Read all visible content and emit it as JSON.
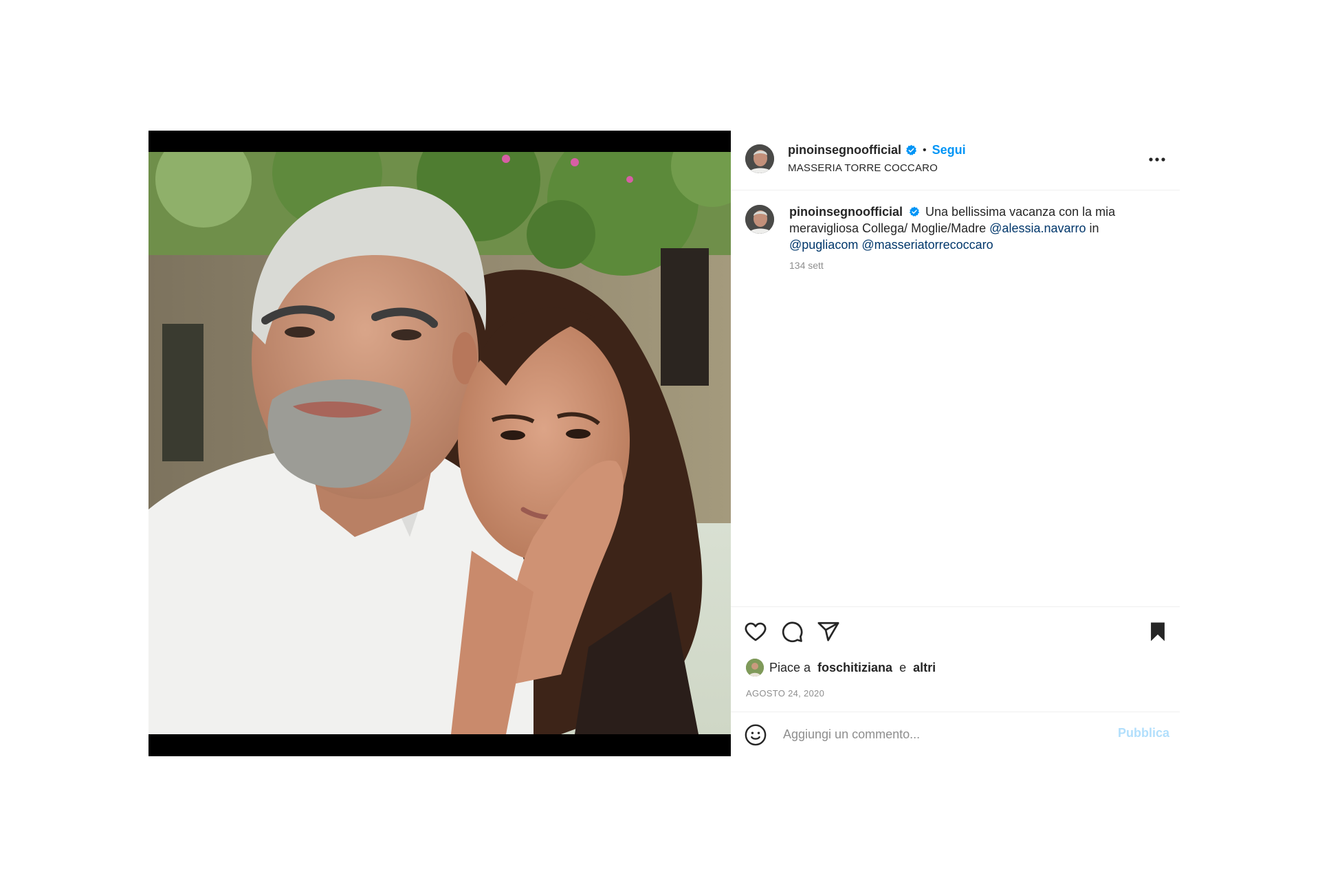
{
  "post": {
    "author": "pinoinsegnoofficial",
    "verified": true,
    "separator": "•",
    "follow_label": "Segui",
    "location": "MASSERIA TORRE COCCARO",
    "more_icon": "more-horizontal-icon",
    "photo_description_icon": "selfie-photo"
  },
  "caption": {
    "author": "pinoinsegnoofficial",
    "text_1": "Una bellissima vacanza con la mia meravigliosa Collega/ Moglie/Madre",
    "mention_1": "@alessia.navarro",
    "text_2": "in",
    "mention_2": "@pugliacom",
    "mention_3": "@masseriatorrecoccaro",
    "age": "134 sett"
  },
  "actions": {
    "like_icon": "heart-icon",
    "comment_icon": "comment-icon",
    "share_icon": "share-icon",
    "save_icon": "bookmark-icon",
    "likes_prefix": "Piace a",
    "likes_user": "foschitiziana",
    "likes_and": "e",
    "likes_others": "altri",
    "date": "AGOSTO 24, 2020"
  },
  "comment": {
    "emoji_icon": "emoji-icon",
    "placeholder": "Aggiungi un commento...",
    "publish_label": "Pubblica"
  },
  "colors": {
    "accent": "#0095f6",
    "mention": "#00376b",
    "publish_disabled": "#b2dffc",
    "muted": "#8e8e8e"
  }
}
